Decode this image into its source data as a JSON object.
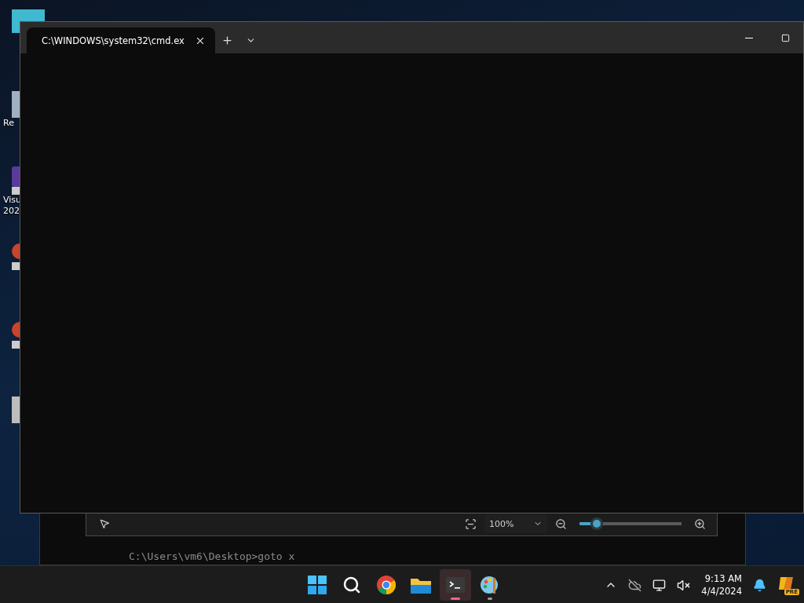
{
  "desktop_icons": [
    {
      "kind": "folder"
    },
    {
      "kind": "bin",
      "labels": [
        "Re"
      ]
    },
    {
      "kind": "studio",
      "labels": [
        "Visu",
        "202"
      ]
    },
    {
      "kind": "red"
    },
    {
      "kind": "red"
    },
    {
      "kind": "gray"
    }
  ],
  "console_window": {
    "prompt": "C:\\Users\\vm6\\Desktop>goto x"
  },
  "image_viewer": {
    "zoom": "100%",
    "zoom_slider": {
      "level": 0.17
    }
  },
  "terminal": {
    "tabs": [
      {
        "title": "C:\\WINDOWS\\system32\\cmd.ex",
        "selected": true
      }
    ]
  },
  "taskbar": {
    "apps": [
      {
        "kind": "start",
        "active": false
      },
      {
        "kind": "search",
        "active": false
      },
      {
        "kind": "chrome",
        "active": false
      },
      {
        "kind": "explorer",
        "active": false
      },
      {
        "kind": "terminal",
        "active": true
      },
      {
        "kind": "paint",
        "active": false
      }
    ],
    "time": "9:13 AM",
    "date": "4/4/2024",
    "copilot_badge": "PRE"
  }
}
